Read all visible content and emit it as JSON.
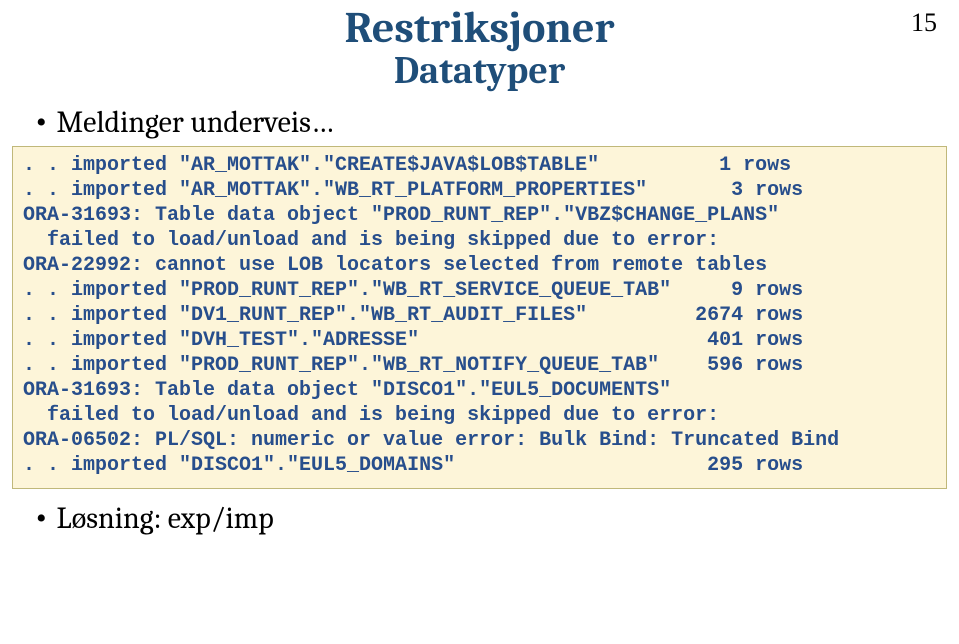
{
  "page_number": "15",
  "title": "Restriksjoner",
  "subtitle": "Datatyper",
  "bullet_top": "Meldinger underveis…",
  "bullet_bottom": "Løsning: exp/imp",
  "code_lines": [
    ". . imported \"AR_MOTTAK\".\"CREATE$JAVA$LOB$TABLE\"          1 rows",
    ". . imported \"AR_MOTTAK\".\"WB_RT_PLATFORM_PROPERTIES\"       3 rows",
    "ORA-31693: Table data object \"PROD_RUNT_REP\".\"VBZ$CHANGE_PLANS\"",
    "  failed to load/unload and is being skipped due to error:",
    "ORA-22992: cannot use LOB locators selected from remote tables",
    ". . imported \"PROD_RUNT_REP\".\"WB_RT_SERVICE_QUEUE_TAB\"     9 rows",
    ". . imported \"DV1_RUNT_REP\".\"WB_RT_AUDIT_FILES\"         2674 rows",
    ". . imported \"DVH_TEST\".\"ADRESSE\"                        401 rows",
    ". . imported \"PROD_RUNT_REP\".\"WB_RT_NOTIFY_QUEUE_TAB\"    596 rows",
    "ORA-31693: Table data object \"DISCO1\".\"EUL5_DOCUMENTS\"",
    "  failed to load/unload and is being skipped due to error:",
    "ORA-06502: PL/SQL: numeric or value error: Bulk Bind: Truncated Bind",
    ". . imported \"DISCO1\".\"EUL5_DOMAINS\"                     295 rows"
  ]
}
